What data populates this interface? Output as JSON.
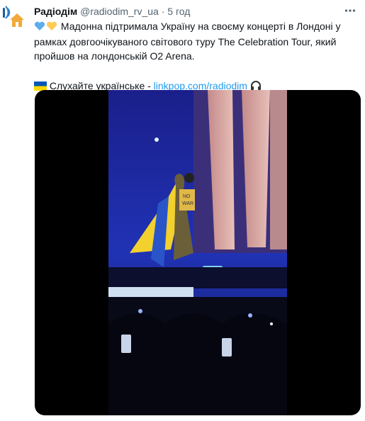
{
  "author": {
    "name": "Радіодім",
    "handle": "@radiodim_rv_ua",
    "separator": "·",
    "time": "5 год"
  },
  "tweet": {
    "text": "Мадонна підтримала Україну на своєму концерті в Лондоні у рамках довгоочікуваного світового туру The Celebration Tour, який пройшов на лондонській O2 Arena.",
    "cta_text": "Слухайте українське - ",
    "link": "linkpop.com/radiodim"
  },
  "media": {
    "type": "video",
    "overlay_texts": [
      "NO",
      "WAR"
    ]
  },
  "icons": {
    "more": "more-horizontal-icon",
    "hearts": "blue-yellow-hearts-icon",
    "flag": "ukraine-flag-icon",
    "headphones": "headphones-icon"
  },
  "colors": {
    "link": "#1d9bf0",
    "secondary_text": "#536471",
    "media_bg": "#000000"
  }
}
